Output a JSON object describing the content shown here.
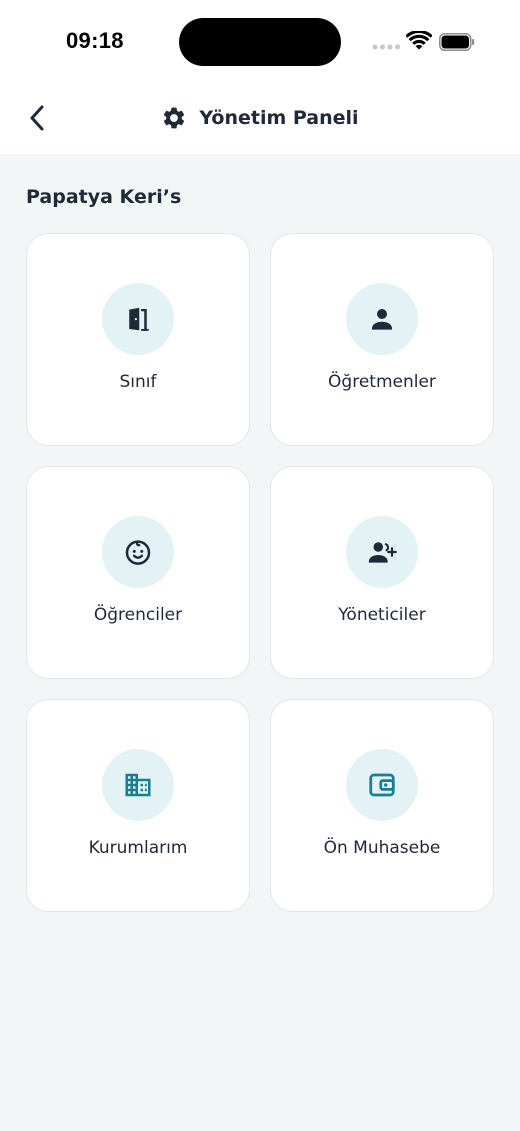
{
  "status_bar": {
    "time": "09:18"
  },
  "header": {
    "title": "Yönetim Paneli",
    "back_icon": "chevron-left-icon",
    "title_icon": "gear-icon"
  },
  "organization": {
    "name": "Papatya Keri’s"
  },
  "menu": [
    {
      "label": "Sınıf",
      "icon": "door-icon",
      "icon_color": "#1f2937"
    },
    {
      "label": "Öğretmenler",
      "icon": "person-icon",
      "icon_color": "#1f2937"
    },
    {
      "label": "Öğrenciler",
      "icon": "baby-face-icon",
      "icon_color": "#1f2937"
    },
    {
      "label": "Yöneticiler",
      "icon": "person-add-icon",
      "icon_color": "#1f2937"
    },
    {
      "label": "Kurumlarım",
      "icon": "building-icon",
      "icon_color": "#1a7e93"
    },
    {
      "label": "Ön Muhasebe",
      "icon": "wallet-icon",
      "icon_color": "#1a7e93"
    }
  ],
  "colors": {
    "background": "#f2f6f7",
    "card": "#ffffff",
    "icon_circle": "#e3f2f5",
    "accent": "#1a7e93",
    "text": "#1f2937"
  }
}
